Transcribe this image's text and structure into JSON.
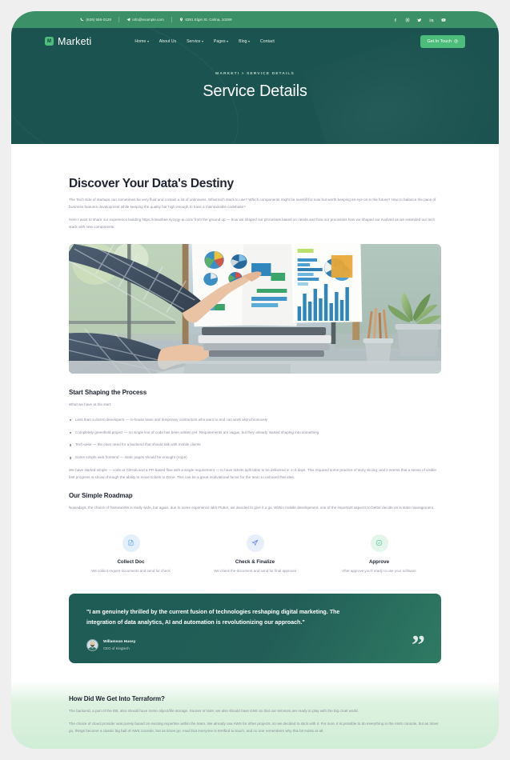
{
  "topbar": {
    "phone": "(629) 555-0129",
    "email": "info@example.com",
    "address": "6391 Elgin St. Celina, 10299",
    "phone_icon": "phone-icon",
    "email_icon": "envelope-icon",
    "address_icon": "map-pin-icon",
    "socials": [
      {
        "name": "facebook-icon"
      },
      {
        "name": "instagram-icon"
      },
      {
        "name": "twitter-icon"
      },
      {
        "name": "linkedin-icon"
      },
      {
        "name": "youtube-icon"
      }
    ]
  },
  "header": {
    "brand_name": "Marketi",
    "brand_mark": "M",
    "nav": [
      {
        "label": "Home",
        "has_caret": true
      },
      {
        "label": "About Us",
        "has_caret": false
      },
      {
        "label": "Service",
        "has_caret": true
      },
      {
        "label": "Pages",
        "has_caret": true
      },
      {
        "label": "Blog",
        "has_caret": true
      },
      {
        "label": "Contact",
        "has_caret": false
      }
    ],
    "cta_label": "Get In Touch",
    "cta_icon": "arrow-up-right-icon"
  },
  "hero": {
    "breadcrumb": "MARKETI > SERVICE DETAILS",
    "title": "Service Details"
  },
  "main": {
    "title": "Discover Your Data's Destiny",
    "paragraph_1": "The Tech side of startups can sometimes be very fluid and contain a lot of unknowns. What tech stack to use? Which components might be overkill for now but worth keeping an eye on in the future? How to balance the pace of business features development while keeping the quality bar high enough to have a maintainable codebase?",
    "paragraph_2": "Here I want to share our experience building https://cleanbee.syzygy-ai.com/ from the ground up — how we shaped our processes based on needs and how our processes how we shaped our evolved as we extended our tech stack with new components.",
    "image_alt": "business-analytics-photo",
    "process": {
      "heading": "Start Shaping the Process",
      "intro": "What we have at the start:",
      "bullets": [
        "Less than a dozen developers — in-house team and temporary contractors who want to and can work asynchronously",
        "Completely greenfield project — no single line of code has been written yet. Requirements are vague, but they already started shaping into something",
        "Tech-wise — the clear need for a backend that should talk with mobile clients",
        "Some simple web frontend — static pages should be enough! (nope)"
      ],
      "closing": "We have started simple — code at GitHub and a PR-based flow with a single requirement — to have tickets split table to be delivered in 1–3 days. This required some practice of story slicing, and it seems that a sense of visible fast progress is shown through the ability to move tickets to Done. This can be a great motivational factor for the team to onboard that idea."
    },
    "roadmap": {
      "heading": "Our Simple Roadmap",
      "paragraph": "Nowadays, the choice of frameworks is really wide, but again, due to some experience with Flutter, we decided to give it a go. Within mobile development, one of the important aspects to better decide on is state management."
    },
    "steps": [
      {
        "icon": "document-icon",
        "name": "Collect Doc",
        "desc": "We collect require documents and send for check"
      },
      {
        "icon": "paper-plane-icon",
        "name": "Check & Finalize",
        "desc": "We check the document and send for final approval"
      },
      {
        "icon": "check-circle-icon",
        "name": "Approve",
        "desc": "After approve you'll ready to use your software"
      }
    ],
    "testimonial": {
      "quote": "\"I am genuinely thrilled by the current fusion of technologies reshaping digital marketing. The integration of data analytics, AI and automation is revolutionizing our approach.\"",
      "author_name": "Willamson Hussy",
      "author_role": "CEO of Kingtech",
      "avatar_name": "author-avatar",
      "quote_mark": "”"
    },
    "terraform": {
      "heading": "How Did We Get Into Terraform?",
      "paragraph_1": "The backend, a part of the DB, also should have some object/file storage. Sooner or later, we also should have DNS so that our services are ready to play with the big cruel world.",
      "paragraph_2": "The choice of cloud provider was purely based on existing expertise within the team. We already use AWS for other projects, so we decided to stick with it. For sure, it is possible to do everything in the AWS console, but as times go, things become a classic big ball of AWS console, but as times go, mud that everyone is terrified to touch, and no one remembers why this bit exists at all."
    }
  },
  "colors": {
    "header_dark": "#1b5350",
    "topbar_green": "#3c9067",
    "accent_green": "#4cbd7a",
    "bottom_gradient": "#cdecd4"
  }
}
